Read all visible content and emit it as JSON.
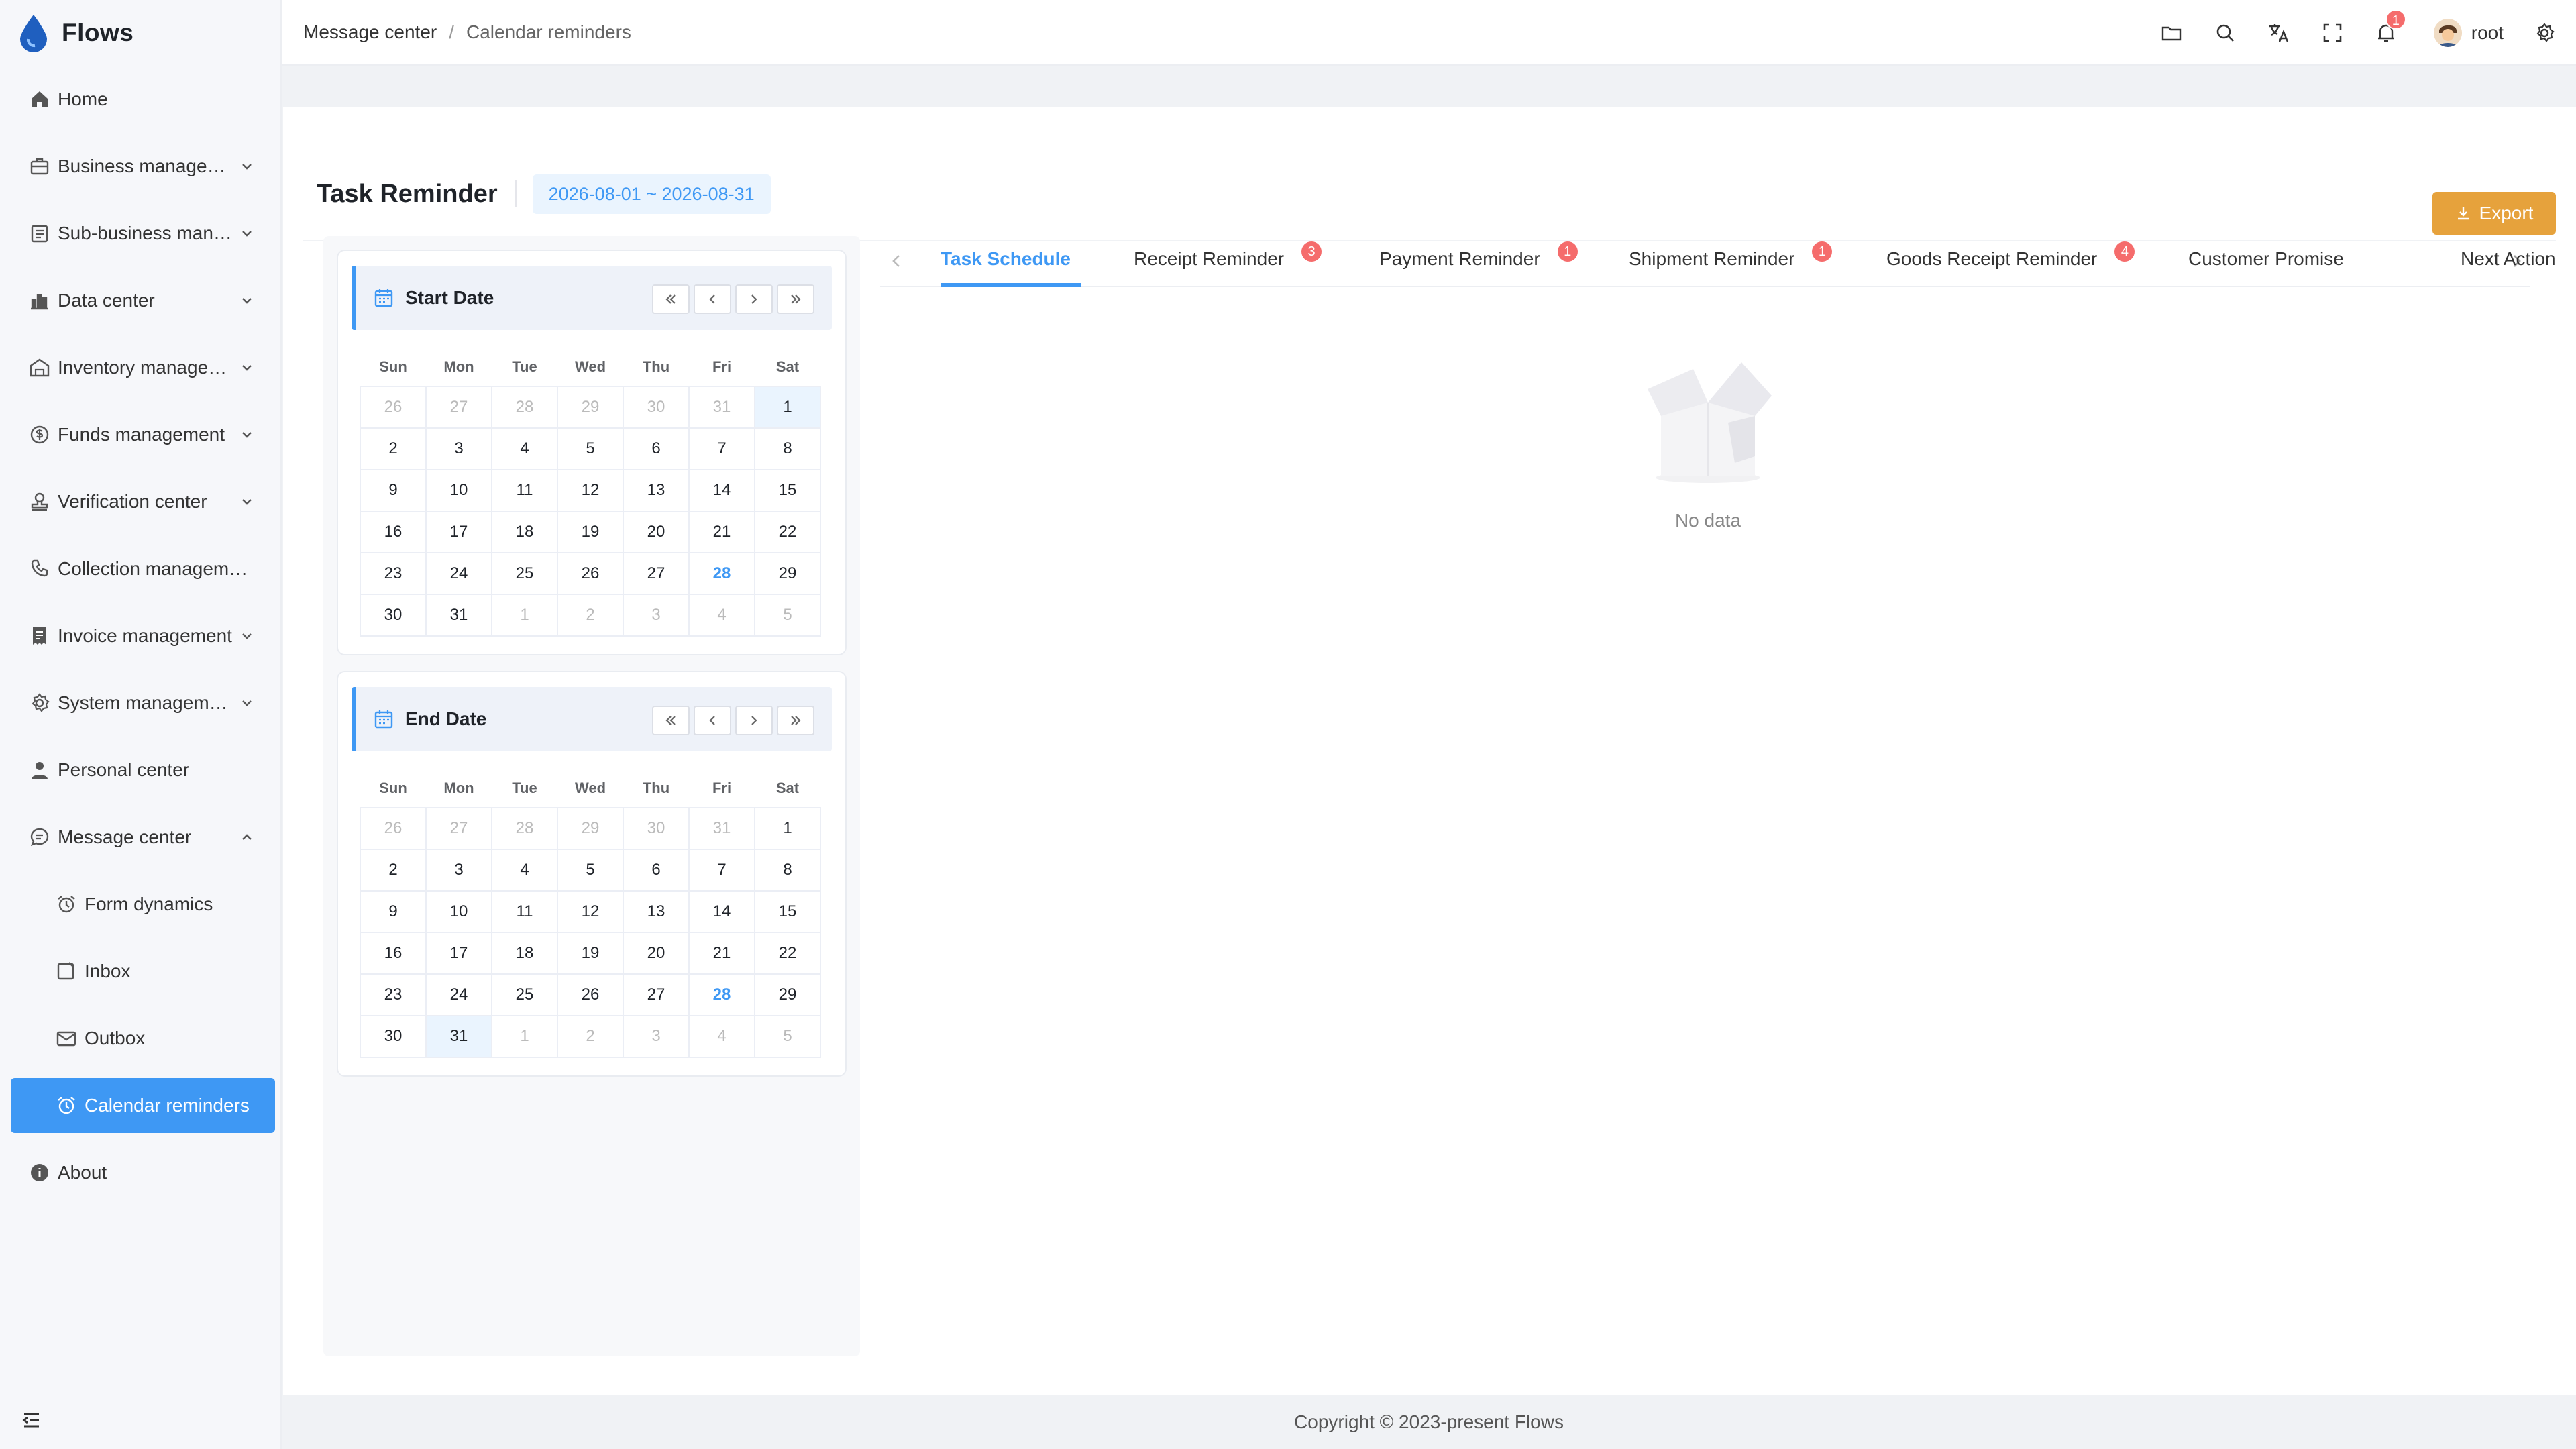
{
  "app": {
    "name": "Flows"
  },
  "sidebar": {
    "items": [
      {
        "label": "Home",
        "icon": "home-icon",
        "arrow": false
      },
      {
        "label": "Business management",
        "icon": "briefcase-icon",
        "arrow": true
      },
      {
        "label": "Sub-business management",
        "icon": "clipboard-icon",
        "arrow": true
      },
      {
        "label": "Data center",
        "icon": "bar-chart-icon",
        "arrow": true
      },
      {
        "label": "Inventory management",
        "icon": "warehouse-icon",
        "arrow": true
      },
      {
        "label": "Funds management",
        "icon": "funds-icon",
        "arrow": true
      },
      {
        "label": "Verification center",
        "icon": "stamp-icon",
        "arrow": true
      },
      {
        "label": "Collection management",
        "icon": "phone-icon",
        "arrow": false
      },
      {
        "label": "Invoice management",
        "icon": "invoice-icon",
        "arrow": true
      },
      {
        "label": "System management",
        "icon": "gear-icon",
        "arrow": true
      },
      {
        "label": "Personal center",
        "icon": "user-icon",
        "arrow": false
      },
      {
        "label": "Message center",
        "icon": "message-icon",
        "arrow": "up"
      }
    ],
    "sub_items": [
      {
        "label": "Form dynamics",
        "icon": "alarm-icon"
      },
      {
        "label": "Inbox",
        "icon": "inbox-icon"
      },
      {
        "label": "Outbox",
        "icon": "mail-icon"
      },
      {
        "label": "Calendar reminders",
        "icon": "alarm-icon",
        "active": true
      }
    ],
    "about": {
      "label": "About",
      "icon": "info-icon"
    }
  },
  "header": {
    "breadcrumb": [
      "Message center",
      "/",
      "Calendar reminders"
    ],
    "notification_count": "1",
    "user": "root"
  },
  "page": {
    "title": "Task Reminder",
    "date_range": "2026-08-01 ~ 2026-08-31",
    "export_label": "Export"
  },
  "calendars": {
    "weekdays": [
      "Sun",
      "Mon",
      "Tue",
      "Wed",
      "Thu",
      "Fri",
      "Sat"
    ],
    "start": {
      "title": "Start Date",
      "selected": "1",
      "today": "28"
    },
    "end": {
      "title": "End Date",
      "selected": "31",
      "today": "28"
    },
    "days": [
      [
        "26",
        "27",
        "28",
        "29",
        "30",
        "31",
        "1"
      ],
      [
        "2",
        "3",
        "4",
        "5",
        "6",
        "7",
        "8"
      ],
      [
        "9",
        "10",
        "11",
        "12",
        "13",
        "14",
        "15"
      ],
      [
        "16",
        "17",
        "18",
        "19",
        "20",
        "21",
        "22"
      ],
      [
        "23",
        "24",
        "25",
        "26",
        "27",
        "28",
        "29"
      ],
      [
        "30",
        "31",
        "1",
        "2",
        "3",
        "4",
        "5"
      ]
    ]
  },
  "tabs": [
    {
      "label": "Task Schedule",
      "badge": "",
      "active": true
    },
    {
      "label": "Receipt Reminder",
      "badge": "3"
    },
    {
      "label": "Payment Reminder",
      "badge": "1"
    },
    {
      "label": "Shipment Reminder",
      "badge": "1"
    },
    {
      "label": "Goods Receipt Reminder",
      "badge": "4"
    },
    {
      "label": "Customer Promise",
      "badge": ""
    },
    {
      "label": "Next Action",
      "badge": ""
    }
  ],
  "empty_text": "No data",
  "footer": "Copyright © 2023-present Flows",
  "colors": {
    "accent": "#3e98f4",
    "export": "#e6a23c",
    "badge": "#f56c6c"
  }
}
